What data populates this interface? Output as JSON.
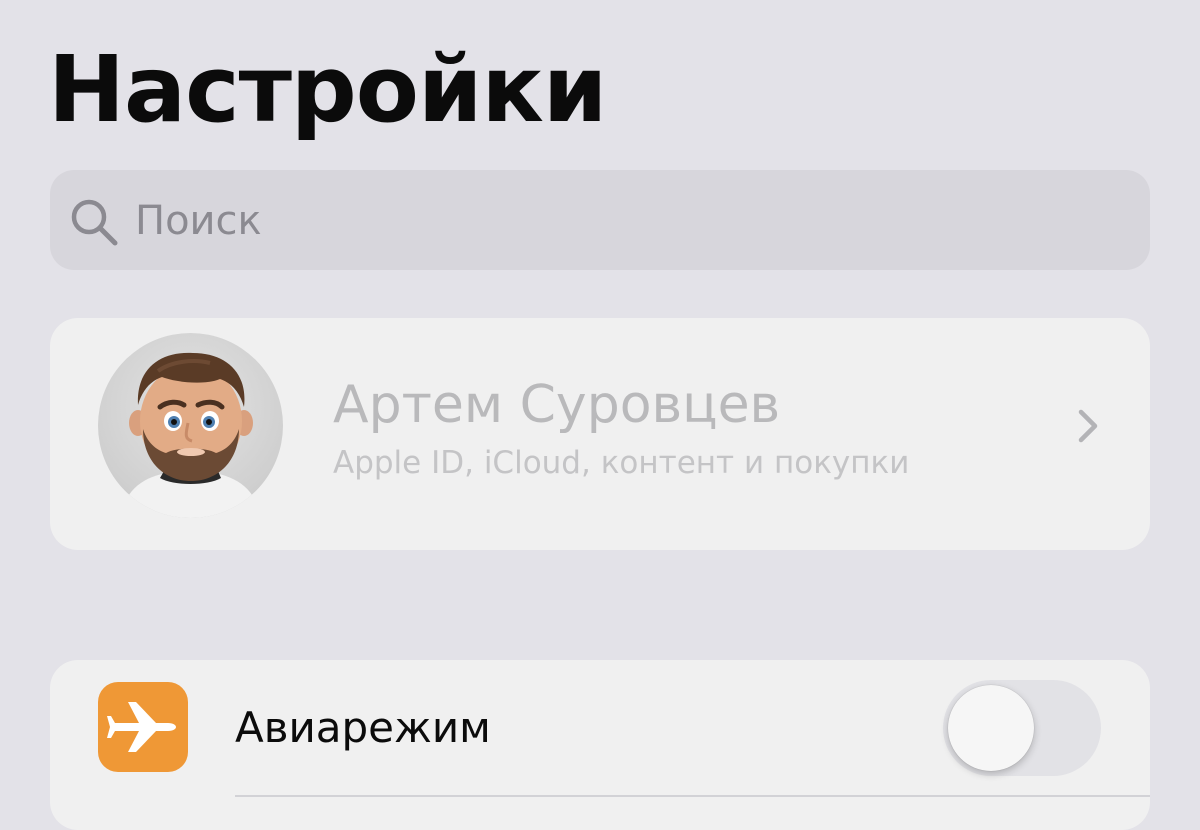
{
  "header": {
    "title": "Настройки"
  },
  "search": {
    "placeholder": "Поиск",
    "icon": "search-icon"
  },
  "profile": {
    "name": "Артем Суровцев",
    "subtitle": "Apple ID, iCloud, контент и покупки",
    "avatar": "memoji-avatar",
    "chevron": "chevron-right-icon"
  },
  "settings": {
    "rows": [
      {
        "label": "Авиарежим",
        "icon": "airplane-icon",
        "icon_color": "#EF9836",
        "toggle_on": false
      }
    ]
  },
  "colors": {
    "background": "#E3E2E8",
    "card": "#F0F0F0",
    "search_field": "#D7D6DC"
  }
}
